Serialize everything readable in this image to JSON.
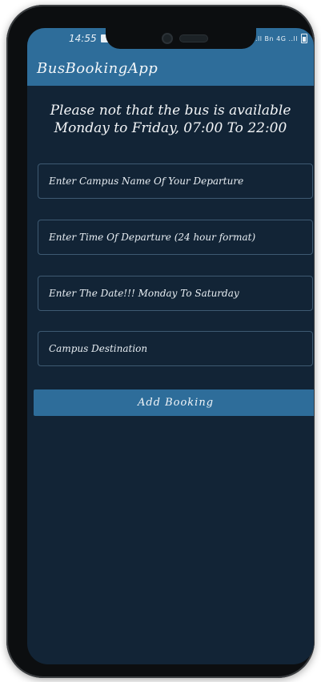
{
  "status_bar": {
    "time": "14:55",
    "right_icons": "Bn..ll Bn 4G ..ll"
  },
  "app_bar": {
    "title": "BusBookingApp"
  },
  "notice": {
    "line1": "Please not that the bus is available",
    "line2": "Monday to Friday, 07:00 To 22:00"
  },
  "form": {
    "departure_campus_placeholder": "Enter Campus Name Of Your Departure",
    "departure_time_placeholder": "Enter Time Of Departure (24 hour format)",
    "date_placeholder": "Enter The Date!!! Monday To Saturday",
    "destination_placeholder": "Campus Destination",
    "departure_campus_value": "",
    "departure_time_value": "",
    "date_value": "",
    "destination_value": ""
  },
  "actions": {
    "add_booking_label": "Add Booking"
  },
  "colors": {
    "primary": "#2e6d9a",
    "background": "#122436",
    "field_border": "#3e5a72"
  }
}
